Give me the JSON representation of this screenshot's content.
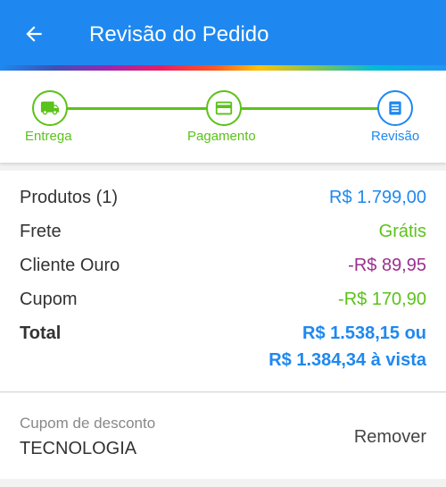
{
  "header": {
    "title": "Revisão do Pedido",
    "back_icon": "arrow-left-icon",
    "background": "#1e88f0"
  },
  "stepper": {
    "steps": [
      {
        "label": "Entrega",
        "icon": "truck-icon",
        "state": "done"
      },
      {
        "label": "Pagamento",
        "icon": "credit-card-icon",
        "state": "done"
      },
      {
        "label": "Revisão",
        "icon": "receipt-icon",
        "state": "current"
      }
    ],
    "done_color": "#5bc219",
    "current_color": "#1e88f0"
  },
  "summary": {
    "products": {
      "label": "Produtos (1)",
      "value": "R$ 1.799,00",
      "color": "#1e88f0"
    },
    "shipping": {
      "label": "Frete",
      "value": "Grátis",
      "color": "#5bc219"
    },
    "gold_client": {
      "label": "Cliente Ouro",
      "value": "-R$ 89,95",
      "color": "#9b2f8f"
    },
    "coupon": {
      "label": "Cupom",
      "value": "-R$ 170,90",
      "color": "#5bc219"
    },
    "total": {
      "label": "Total",
      "value_line1": "R$ 1.538,15 ou",
      "value_line2": "R$ 1.384,34 à vista"
    }
  },
  "coupon_box": {
    "caption": "Cupom de desconto",
    "code": "TECNOLOGIA",
    "remove_label": "Remover"
  }
}
